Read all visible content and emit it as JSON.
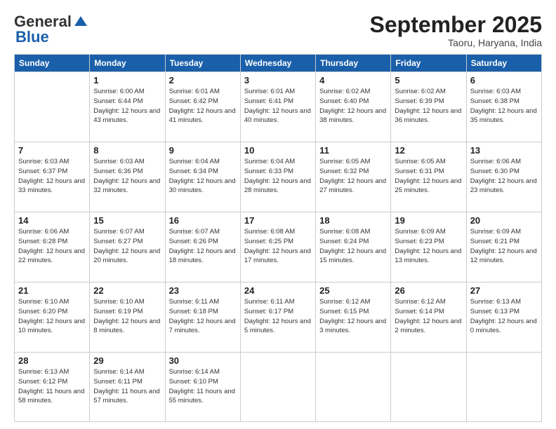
{
  "header": {
    "logo_line1": "General",
    "logo_line2": "Blue",
    "month": "September 2025",
    "location": "Taoru, Haryana, India"
  },
  "weekdays": [
    "Sunday",
    "Monday",
    "Tuesday",
    "Wednesday",
    "Thursday",
    "Friday",
    "Saturday"
  ],
  "weeks": [
    [
      null,
      {
        "day": 1,
        "sunrise": "6:00 AM",
        "sunset": "6:44 PM",
        "daylight": "12 hours and 43 minutes."
      },
      {
        "day": 2,
        "sunrise": "6:01 AM",
        "sunset": "6:42 PM",
        "daylight": "12 hours and 41 minutes."
      },
      {
        "day": 3,
        "sunrise": "6:01 AM",
        "sunset": "6:41 PM",
        "daylight": "12 hours and 40 minutes."
      },
      {
        "day": 4,
        "sunrise": "6:02 AM",
        "sunset": "6:40 PM",
        "daylight": "12 hours and 38 minutes."
      },
      {
        "day": 5,
        "sunrise": "6:02 AM",
        "sunset": "6:39 PM",
        "daylight": "12 hours and 36 minutes."
      },
      {
        "day": 6,
        "sunrise": "6:03 AM",
        "sunset": "6:38 PM",
        "daylight": "12 hours and 35 minutes."
      }
    ],
    [
      {
        "day": 7,
        "sunrise": "6:03 AM",
        "sunset": "6:37 PM",
        "daylight": "12 hours and 33 minutes."
      },
      {
        "day": 8,
        "sunrise": "6:03 AM",
        "sunset": "6:36 PM",
        "daylight": "12 hours and 32 minutes."
      },
      {
        "day": 9,
        "sunrise": "6:04 AM",
        "sunset": "6:34 PM",
        "daylight": "12 hours and 30 minutes."
      },
      {
        "day": 10,
        "sunrise": "6:04 AM",
        "sunset": "6:33 PM",
        "daylight": "12 hours and 28 minutes."
      },
      {
        "day": 11,
        "sunrise": "6:05 AM",
        "sunset": "6:32 PM",
        "daylight": "12 hours and 27 minutes."
      },
      {
        "day": 12,
        "sunrise": "6:05 AM",
        "sunset": "6:31 PM",
        "daylight": "12 hours and 25 minutes."
      },
      {
        "day": 13,
        "sunrise": "6:06 AM",
        "sunset": "6:30 PM",
        "daylight": "12 hours and 23 minutes."
      }
    ],
    [
      {
        "day": 14,
        "sunrise": "6:06 AM",
        "sunset": "6:28 PM",
        "daylight": "12 hours and 22 minutes."
      },
      {
        "day": 15,
        "sunrise": "6:07 AM",
        "sunset": "6:27 PM",
        "daylight": "12 hours and 20 minutes."
      },
      {
        "day": 16,
        "sunrise": "6:07 AM",
        "sunset": "6:26 PM",
        "daylight": "12 hours and 18 minutes."
      },
      {
        "day": 17,
        "sunrise": "6:08 AM",
        "sunset": "6:25 PM",
        "daylight": "12 hours and 17 minutes."
      },
      {
        "day": 18,
        "sunrise": "6:08 AM",
        "sunset": "6:24 PM",
        "daylight": "12 hours and 15 minutes."
      },
      {
        "day": 19,
        "sunrise": "6:09 AM",
        "sunset": "6:23 PM",
        "daylight": "12 hours and 13 minutes."
      },
      {
        "day": 20,
        "sunrise": "6:09 AM",
        "sunset": "6:21 PM",
        "daylight": "12 hours and 12 minutes."
      }
    ],
    [
      {
        "day": 21,
        "sunrise": "6:10 AM",
        "sunset": "6:20 PM",
        "daylight": "12 hours and 10 minutes."
      },
      {
        "day": 22,
        "sunrise": "6:10 AM",
        "sunset": "6:19 PM",
        "daylight": "12 hours and 8 minutes."
      },
      {
        "day": 23,
        "sunrise": "6:11 AM",
        "sunset": "6:18 PM",
        "daylight": "12 hours and 7 minutes."
      },
      {
        "day": 24,
        "sunrise": "6:11 AM",
        "sunset": "6:17 PM",
        "daylight": "12 hours and 5 minutes."
      },
      {
        "day": 25,
        "sunrise": "6:12 AM",
        "sunset": "6:15 PM",
        "daylight": "12 hours and 3 minutes."
      },
      {
        "day": 26,
        "sunrise": "6:12 AM",
        "sunset": "6:14 PM",
        "daylight": "12 hours and 2 minutes."
      },
      {
        "day": 27,
        "sunrise": "6:13 AM",
        "sunset": "6:13 PM",
        "daylight": "12 hours and 0 minutes."
      }
    ],
    [
      {
        "day": 28,
        "sunrise": "6:13 AM",
        "sunset": "6:12 PM",
        "daylight": "11 hours and 58 minutes."
      },
      {
        "day": 29,
        "sunrise": "6:14 AM",
        "sunset": "6:11 PM",
        "daylight": "11 hours and 57 minutes."
      },
      {
        "day": 30,
        "sunrise": "6:14 AM",
        "sunset": "6:10 PM",
        "daylight": "11 hours and 55 minutes."
      },
      null,
      null,
      null,
      null
    ]
  ]
}
